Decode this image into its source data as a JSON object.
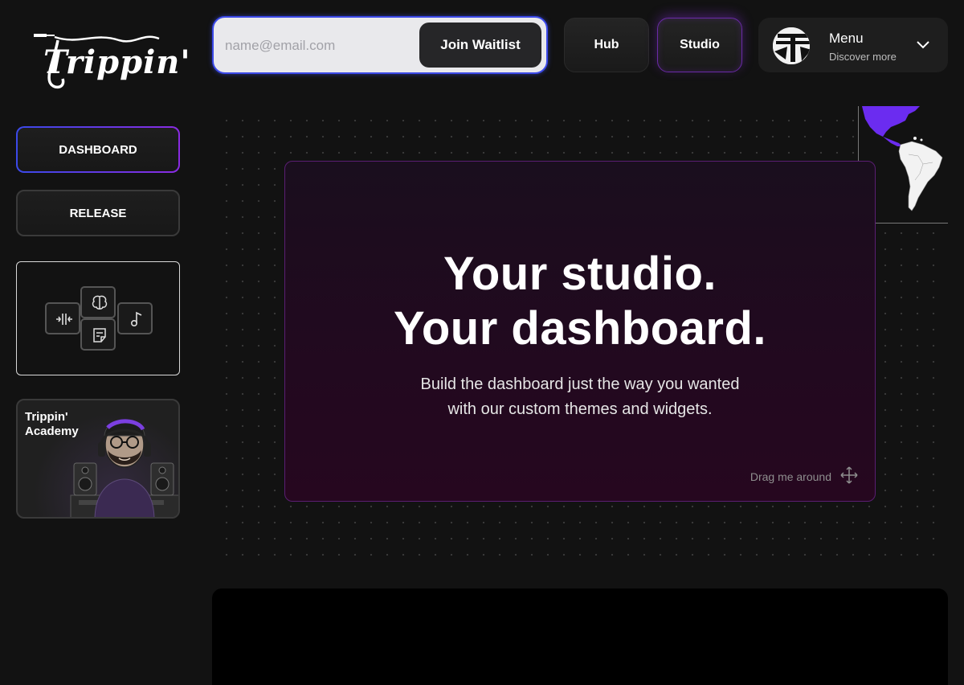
{
  "brand": {
    "logo_text": "Trippin'"
  },
  "waitlist": {
    "placeholder": "name@email.com",
    "button_label": "Join Waitlist"
  },
  "top_nav": {
    "hub_label": "Hub",
    "studio_label": "Studio"
  },
  "menu": {
    "title": "Menu",
    "subtitle": "Discover more"
  },
  "sidebar": {
    "items": [
      {
        "label": "DASHBOARD",
        "active": true
      },
      {
        "label": "RELEASE",
        "active": false
      }
    ],
    "widget_icons": [
      "waveform-icon",
      "brain-icon",
      "music-note-icon",
      "note-icon"
    ],
    "academy": {
      "title": "Trippin' Academy"
    }
  },
  "hero": {
    "title_line1": "Your studio.",
    "title_line2": "Your dashboard.",
    "subtitle_line1": "Build the dashboard just the way you wanted",
    "subtitle_line2": "with our custom themes and widgets.",
    "drag_hint": "Drag me around"
  },
  "colors": {
    "background": "#121212",
    "accent_blue": "#3b49e8",
    "accent_purple": "#8a2be2",
    "map_highlight": "#6b2cf0"
  }
}
